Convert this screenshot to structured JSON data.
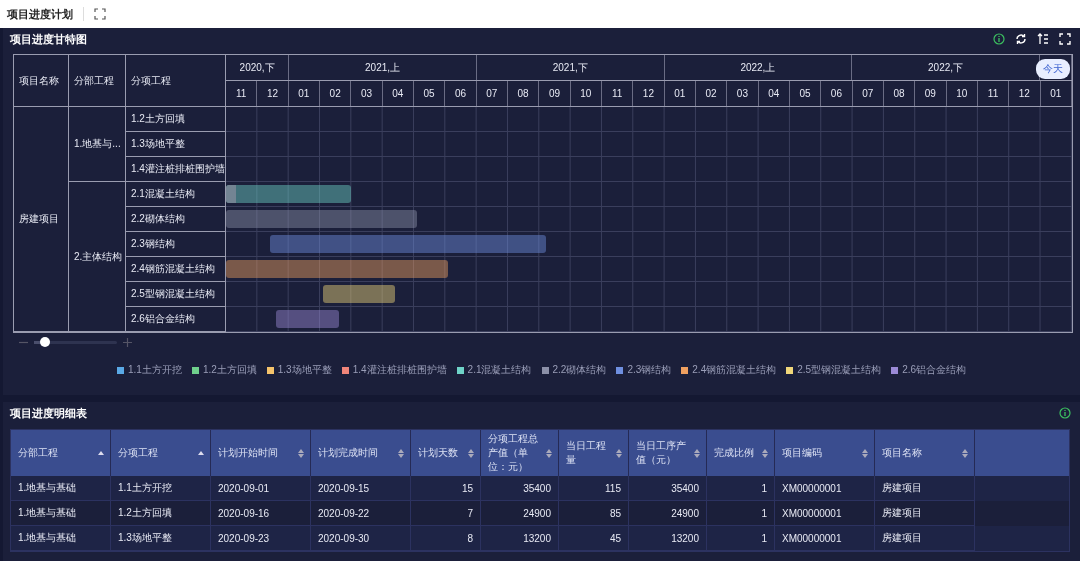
{
  "page_title": "项目进度计划",
  "gantt": {
    "title": "项目进度甘特图",
    "today_button": "今天",
    "columns": [
      "项目名称",
      "分部工程",
      "分项工程"
    ],
    "halves": [
      {
        "label": "2020,下",
        "months": [
          "11",
          "12"
        ]
      },
      {
        "label": "2021,上",
        "months": [
          "01",
          "02",
          "03",
          "04",
          "05",
          "06"
        ]
      },
      {
        "label": "2021,下",
        "months": [
          "07",
          "08",
          "09",
          "10",
          "11",
          "12"
        ]
      },
      {
        "label": "2022,上",
        "months": [
          "01",
          "02",
          "03",
          "04",
          "05",
          "06"
        ]
      },
      {
        "label": "2022,下",
        "months": [
          "07",
          "08",
          "09",
          "10",
          "11",
          "12"
        ]
      },
      {
        "months": [
          "01"
        ]
      }
    ],
    "project": "房建项目",
    "groups": [
      {
        "name": "1.地基与...",
        "tasks": [
          {
            "name": "1.2土方回填"
          },
          {
            "name": "1.3场地平整"
          },
          {
            "name": "1.4灌注桩排桩围护墙"
          }
        ]
      },
      {
        "name": "2.主体结构",
        "tasks": [
          {
            "name": "2.1混凝土结构"
          },
          {
            "name": "2.2砌体结构"
          },
          {
            "name": "2.3钢结构"
          },
          {
            "name": "2.4钢筋混凝土结构"
          },
          {
            "name": "2.5型钢混凝土结构"
          },
          {
            "name": "2.6铝合金结构"
          }
        ]
      }
    ],
    "zoom": {
      "level": 0.13
    },
    "legend": [
      {
        "label": "1.1土方开挖",
        "color": "#5aa9e6"
      },
      {
        "label": "1.2土方回填",
        "color": "#6fd08c"
      },
      {
        "label": "1.3场地平整",
        "color": "#f5c36b"
      },
      {
        "label": "1.4灌注桩排桩围护墙",
        "color": "#f0857a"
      },
      {
        "label": "2.1混凝土结构",
        "color": "#6fd3c8"
      },
      {
        "label": "2.2砌体结构",
        "color": "#8c90a8"
      },
      {
        "label": "2.3钢结构",
        "color": "#6f8fe0"
      },
      {
        "label": "2.4钢筋混凝土结构",
        "color": "#f0a060"
      },
      {
        "label": "2.5型钢混凝土结构",
        "color": "#f0d77a"
      },
      {
        "label": "2.6铝合金结构",
        "color": "#9b8ad6"
      }
    ]
  },
  "table": {
    "title": "项目进度明细表",
    "columns": [
      {
        "label": "分部工程",
        "sorted": true
      },
      {
        "label": "分项工程",
        "sorted": true
      },
      {
        "label": "计划开始时间",
        "sorted": false
      },
      {
        "label": "计划完成时间",
        "sorted": false
      },
      {
        "label": "计划天数",
        "sorted": false
      },
      {
        "label": "分项工程总产值（单位：元）",
        "sorted": false
      },
      {
        "label": "当日工程量",
        "sorted": false
      },
      {
        "label": "当日工序产值（元）",
        "sorted": false
      },
      {
        "label": "完成比例",
        "sorted": false
      },
      {
        "label": "项目编码",
        "sorted": false
      },
      {
        "label": "项目名称",
        "sorted": false
      }
    ],
    "rows": [
      [
        "1.地基与基础",
        "1.1土方开挖",
        "2020-09-01",
        "2020-09-15",
        "15",
        "35400",
        "115",
        "35400",
        "1",
        "XM00000001",
        "房建项目"
      ],
      [
        "1.地基与基础",
        "1.2土方回填",
        "2020-09-16",
        "2020-09-22",
        "7",
        "24900",
        "85",
        "24900",
        "1",
        "XM00000001",
        "房建项目"
      ],
      [
        "1.地基与基础",
        "1.3场地平整",
        "2020-09-23",
        "2020-09-30",
        "8",
        "13200",
        "45",
        "13200",
        "1",
        "XM00000001",
        "房建项目"
      ]
    ]
  }
}
